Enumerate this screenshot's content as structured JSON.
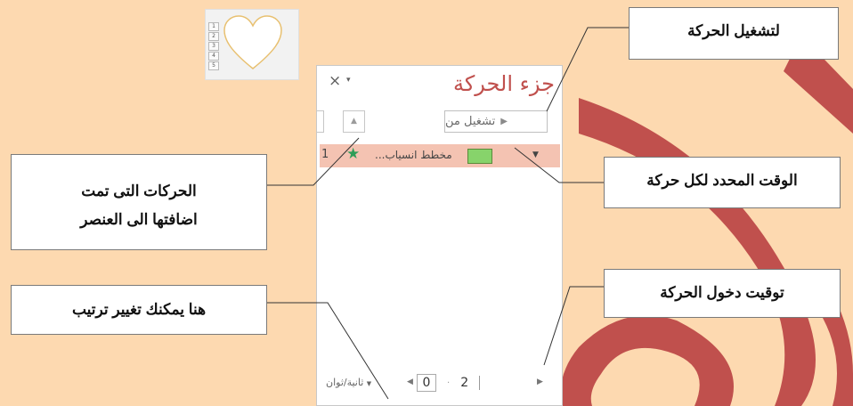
{
  "slide": {
    "thumbnail_numbers": [
      "1",
      "2",
      "3",
      "4",
      "5"
    ]
  },
  "pane": {
    "title": "جزء الحركة",
    "close_symbol": "×",
    "caret_symbol": "▾",
    "play_button_label": "تشغيل من",
    "up_arrow": "▲",
    "animation_items": [
      {
        "index": "1",
        "label": "مخطط انسياب...",
        "icon": "star-icon",
        "icon_color": "#2e9d57",
        "swatch_color": "#87d36b"
      }
    ],
    "footer": {
      "timing_label": "ثانية/ثوان",
      "zoom_start": "0",
      "zoom_end": "2"
    }
  },
  "callouts": {
    "play": "لتشغيل الحركة",
    "added_line1": "الحركات التى تمت",
    "added_line2": "اضافتها الى العنصر",
    "duration": "الوقت المحدد لكل حركة",
    "entry_timing": "توقيت دخول الحركة",
    "reorder": "هنا يمكنك تغيير ترتيب"
  },
  "colors": {
    "background": "#fdd9b0",
    "deco_stroke": "#c0504d",
    "title": "#c0504d",
    "selected_row": "#f4c3b2"
  }
}
